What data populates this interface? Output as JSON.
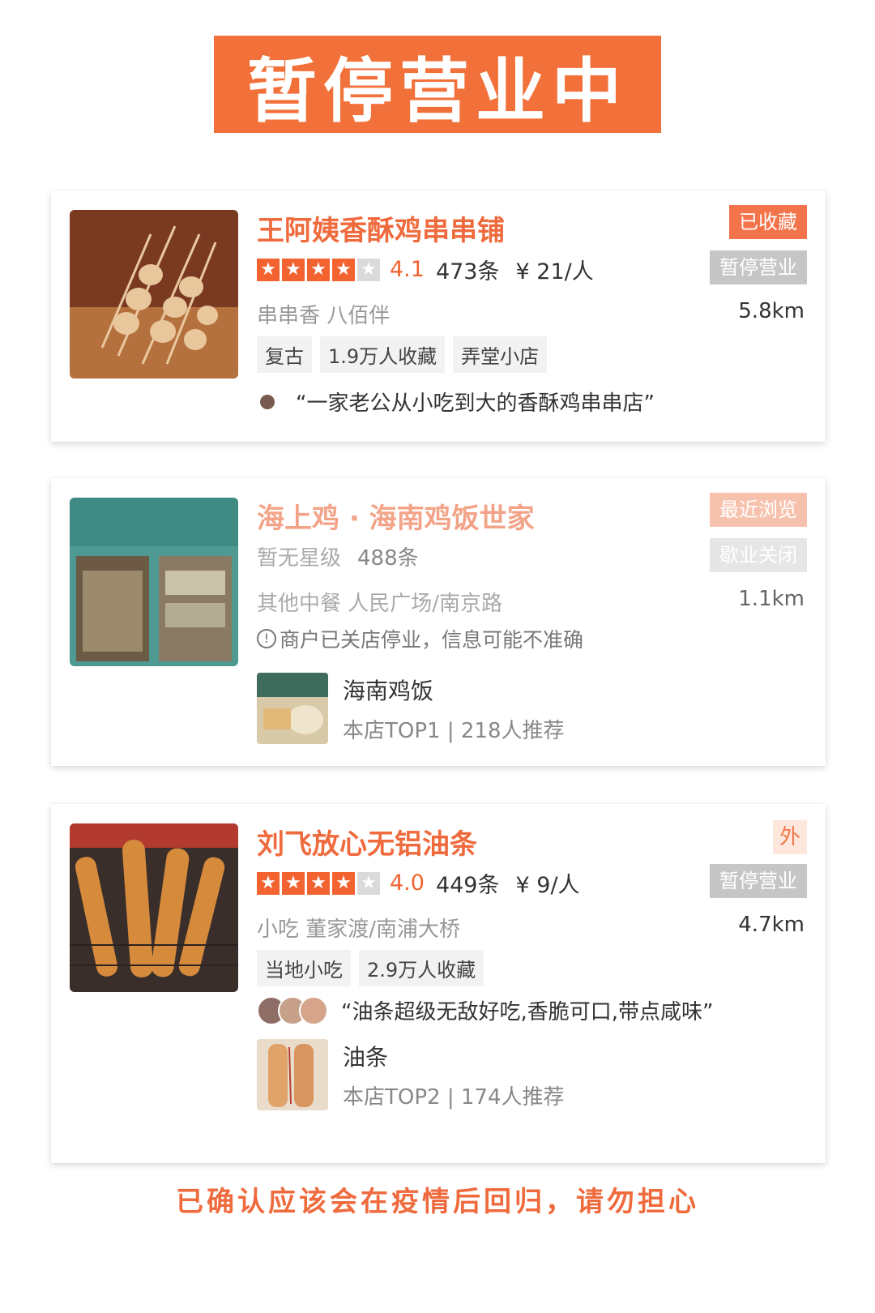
{
  "banner": "暂停营业中",
  "footer": "已确认应该会在疫情后回归，请勿担心",
  "cards": [
    {
      "title": "王阿姨香酥鸡串串铺",
      "badge_top": "已收藏",
      "badge_status": "暂停营业",
      "rating": "4.1",
      "reviews": "473条",
      "price": "¥ 21/人",
      "category_area": "串串香  八佰伴",
      "distance": "5.8km",
      "chips": [
        "复古",
        "1.9万人收藏",
        "弄堂小店"
      ],
      "quote": "“一家老公从小吃到大的香酥鸡串串店”",
      "stars": 4
    },
    {
      "title": "海上鸡 · 海南鸡饭世家",
      "badge_top": "最近浏览",
      "badge_status": "歇业关闭",
      "rating_text": "暂无星级",
      "reviews": "488条",
      "category_area": "其他中餐  人民广场/南京路",
      "distance": "1.1km",
      "warning": "商户已关店停业，信息可能不准确",
      "dish": {
        "name": "海南鸡饭",
        "meta": "本店TOP1 | 218人推荐"
      }
    },
    {
      "title": "刘飞放心无铝油条",
      "badge_top": "外",
      "badge_status": "暂停营业",
      "rating": "4.0",
      "reviews": "449条",
      "price": "¥ 9/人",
      "category_area": "小吃  董家渡/南浦大桥",
      "distance": "4.7km",
      "chips": [
        "当地小吃",
        "2.9万人收藏"
      ],
      "quote": "“油条超级无敌好吃,香脆可口,带点咸味”",
      "dish": {
        "name": "油条",
        "meta": "本店TOP2 | 174人推荐"
      },
      "stars": 4
    }
  ],
  "colors": {
    "accent": "#f2713a",
    "star": "#f2632f",
    "gray_badge": "#c6c6c6"
  }
}
